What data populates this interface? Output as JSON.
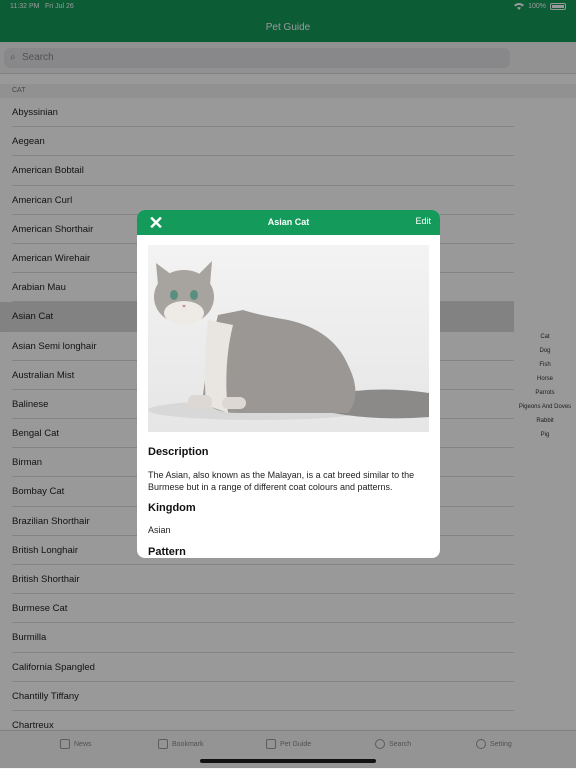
{
  "status_bar": {
    "time": "11:32 PM",
    "date": "Fri Jul 26",
    "battery": "100%"
  },
  "nav": {
    "title": "Pet Guide"
  },
  "search": {
    "placeholder": "Search"
  },
  "list": {
    "section_header": "CAT",
    "items": [
      "Abyssinian",
      "Aegean",
      "American Bobtail",
      "American Curl",
      "American Shorthair",
      "American Wirehair",
      "Arabian Mau",
      "Asian Cat",
      "Asian Semi longhair",
      "Australian Mist",
      "Balinese",
      "Bengal Cat",
      "Birman",
      "Bombay Cat",
      "Brazilian Shorthair",
      "British Longhair",
      "British Shorthair",
      "Burmese Cat",
      "Burmilla",
      "California Spangled",
      "Chantilly Tiffany",
      "Chartreux"
    ],
    "selected": "Asian Cat"
  },
  "index": [
    "Cat",
    "Dog",
    "Fish",
    "Horse",
    "Parrots",
    "Pigeons And Doves",
    "Rabbit",
    "Pig"
  ],
  "modal": {
    "close_symbol": "✕",
    "title": "Asian Cat",
    "edit_label": "Edit",
    "description_heading": "Description",
    "description_text": "The Asian, also known as the Malayan, is a cat breed similar to the Burmese but in a range of different coat colours and patterns.",
    "kingdom_heading": "Kingdom",
    "kingdom_value": "Asian",
    "pattern_heading": "Pattern"
  },
  "tabs": [
    "News",
    "Bookmark",
    "Pet Guide",
    "Search",
    "Setting"
  ]
}
